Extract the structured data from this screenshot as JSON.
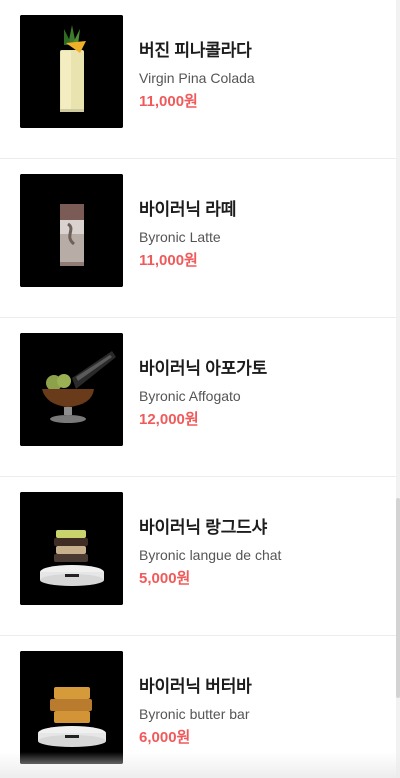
{
  "menu": {
    "items": [
      {
        "name_ko": "버진 피나콜라다",
        "name_en": "Virgin Pina Colada",
        "price": "11,000원",
        "image": "pina-colada-drink"
      },
      {
        "name_ko": "바이러닉 라떼",
        "name_en": "Byronic Latte",
        "price": "11,000원",
        "image": "latte-drink"
      },
      {
        "name_ko": "바이러닉 아포가토",
        "name_en": "Byronic Affogato",
        "price": "12,000원",
        "image": "affogato-dessert"
      },
      {
        "name_ko": "바이러닉 랑그드샤",
        "name_en": "Byronic langue de chat",
        "price": "5,000원",
        "image": "langue-de-chat-cookies"
      },
      {
        "name_ko": "바이러닉 버터바",
        "name_en": "Byronic butter bar",
        "price": "6,000원",
        "image": "butter-bar-dessert"
      }
    ]
  },
  "colors": {
    "price": "#f05a5a",
    "title": "#1c1c1c",
    "subtitle": "#555555",
    "thumbnail_bg": "#000000"
  }
}
